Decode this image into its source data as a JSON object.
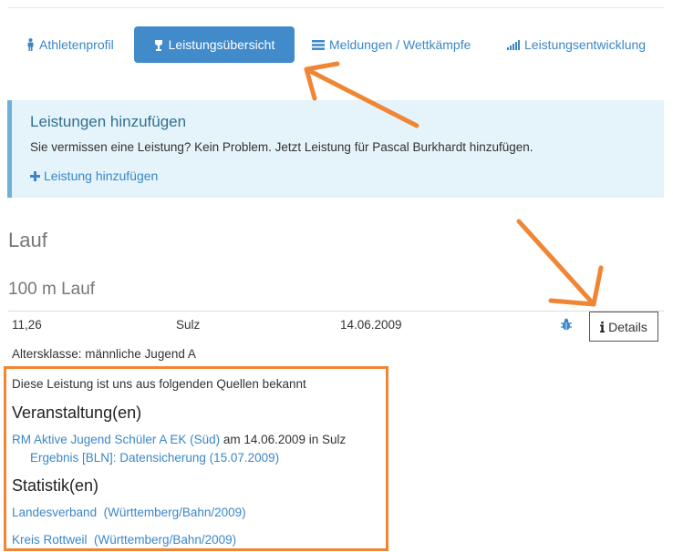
{
  "tabs": [
    {
      "label": "Athletenprofil",
      "icon": "person-icon",
      "active": false
    },
    {
      "label": "Leistungsübersicht",
      "icon": "trophy-icon",
      "active": true
    },
    {
      "label": "Meldungen / Wettkämpfe",
      "icon": "list-icon",
      "active": false
    },
    {
      "label": "Leistungsentwicklung",
      "icon": "bar-chart-icon",
      "active": false
    }
  ],
  "callout": {
    "title": "Leistungen hinzufügen",
    "message": "Sie vermissen eine Leistung? Kein Problem. Jetzt Leistung für Pascal Burkhardt hinzufügen.",
    "add_link": "Leistung hinzufügen"
  },
  "section_title": "Lauf",
  "discipline_title": "100 m Lauf",
  "result_row": {
    "time": "11,26",
    "place": "Sulz",
    "date": "14.06.2009",
    "details_label": "Details"
  },
  "altersklasse": "Altersklasse: männliche Jugend A",
  "sources": {
    "intro": "Diese Leistung ist uns aus folgenden Quellen bekannt",
    "events_heading": "Veranstaltung(en)",
    "event_link": "RM Aktive Jugend Schüler A EK (Süd)",
    "event_text": " am 14.06.2009 in Sulz",
    "result_link": "Ergebnis [BLN]: Datensicherung (15.07.2009)",
    "stats_heading": "Statistik(en)",
    "stat1_name": "Landesverband",
    "stat1_scope": "(Württemberg/Bahn/2009)",
    "stat2_name": "Kreis Rottweil",
    "stat2_scope": "(Württemberg/Bahn/2009)"
  },
  "colors": {
    "accent": "#428bca",
    "link": "#3a87c8",
    "callout_bg": "#e5f3fa",
    "annotation": "#f08634"
  }
}
